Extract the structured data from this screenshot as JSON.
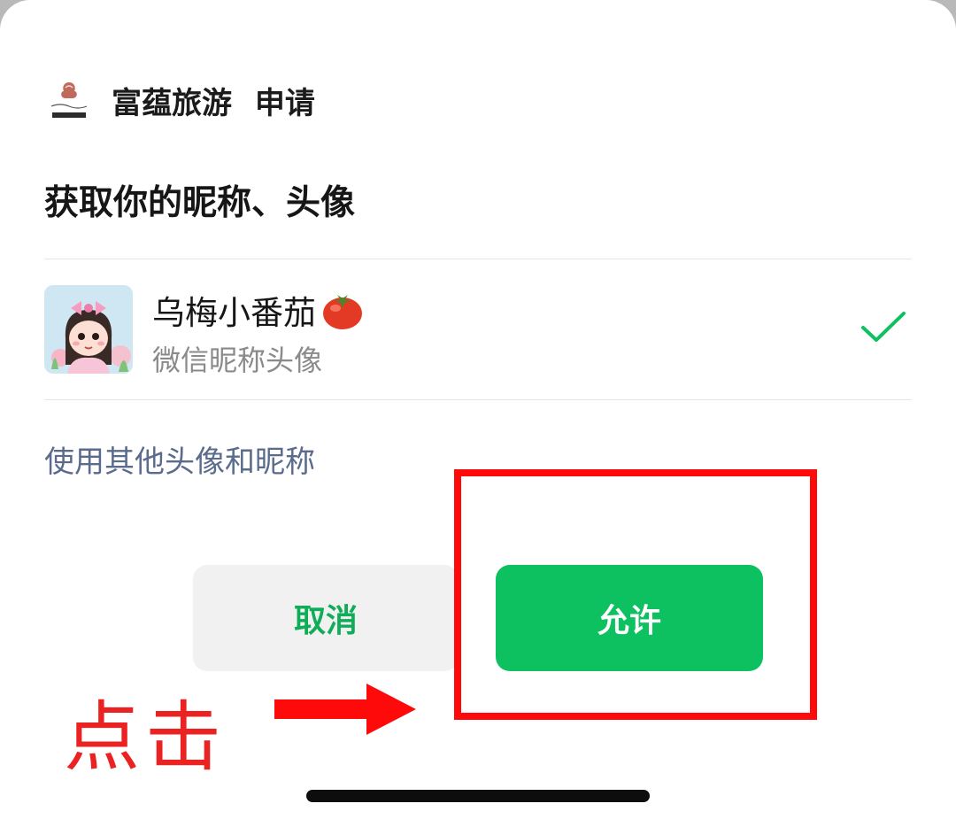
{
  "dialog": {
    "app_name": "富蕴旅游",
    "request_word": "申请",
    "permission_title": "获取你的昵称、头像",
    "profile": {
      "nickname": "乌梅小番茄",
      "subtitle": "微信昵称头像",
      "selected": true
    },
    "other_option_label": "使用其他头像和昵称",
    "cancel_label": "取消",
    "allow_label": "允许"
  },
  "annotation": {
    "click_label": "点击",
    "highlight_color": "#ff0a0a"
  },
  "colors": {
    "primary_green": "#0dc160",
    "cancel_text_green": "#10ad59",
    "link_blue": "#5a6b8c",
    "annotation_red": "#ea2222"
  },
  "icons": {
    "app_logo": "fuyun-tourism-logo",
    "nickname_emoji": "tomato-icon",
    "selected_mark": "checkmark-icon",
    "annotation_arrow": "arrow-right-icon"
  }
}
